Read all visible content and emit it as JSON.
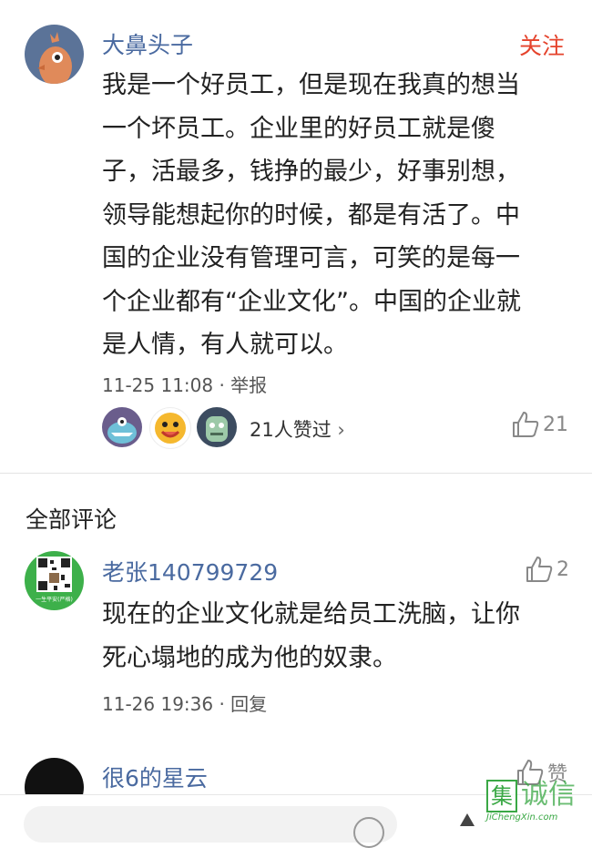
{
  "main_comment": {
    "author": "大鼻头子",
    "follow_label": "关注",
    "lines": [
      "我是一个好员工，但是现在我真的想当",
      "一个坏员工。企业里的好员工就是傻",
      "子，活最多，钱挣的最少，好事别想，",
      "领导能想起你的时候，都是有活了。中",
      "国的企业没有管理可言，可笑的是每一",
      "个企业都有“企业文化”。中国的企业就",
      "是人情，有人就可以。"
    ],
    "timestamp": "11-25 11:08",
    "report_label": "· 举报",
    "likers_text": "21人赞过",
    "likers_chevron": "›",
    "like_count": "21"
  },
  "section_title": "全部评论",
  "replies": [
    {
      "author": "老张140799729",
      "lines": [
        "现在的企业文化就是给员工洗脑，让你",
        "死心塌地的成为他的奴隶。"
      ],
      "timestamp": "11-26 19:36",
      "reply_label": "· 回复",
      "like_count": "2",
      "avatar_caption": "一生平安(严格)"
    },
    {
      "author": "很6的星云",
      "like_label": "赞"
    }
  ],
  "watermark": {
    "char": "集",
    "text": "诚信",
    "url": "JiChengXin.com"
  },
  "colors": {
    "follow": "#e5432c",
    "author": "#4a6aa0",
    "watermark_green": "#3aa845"
  }
}
